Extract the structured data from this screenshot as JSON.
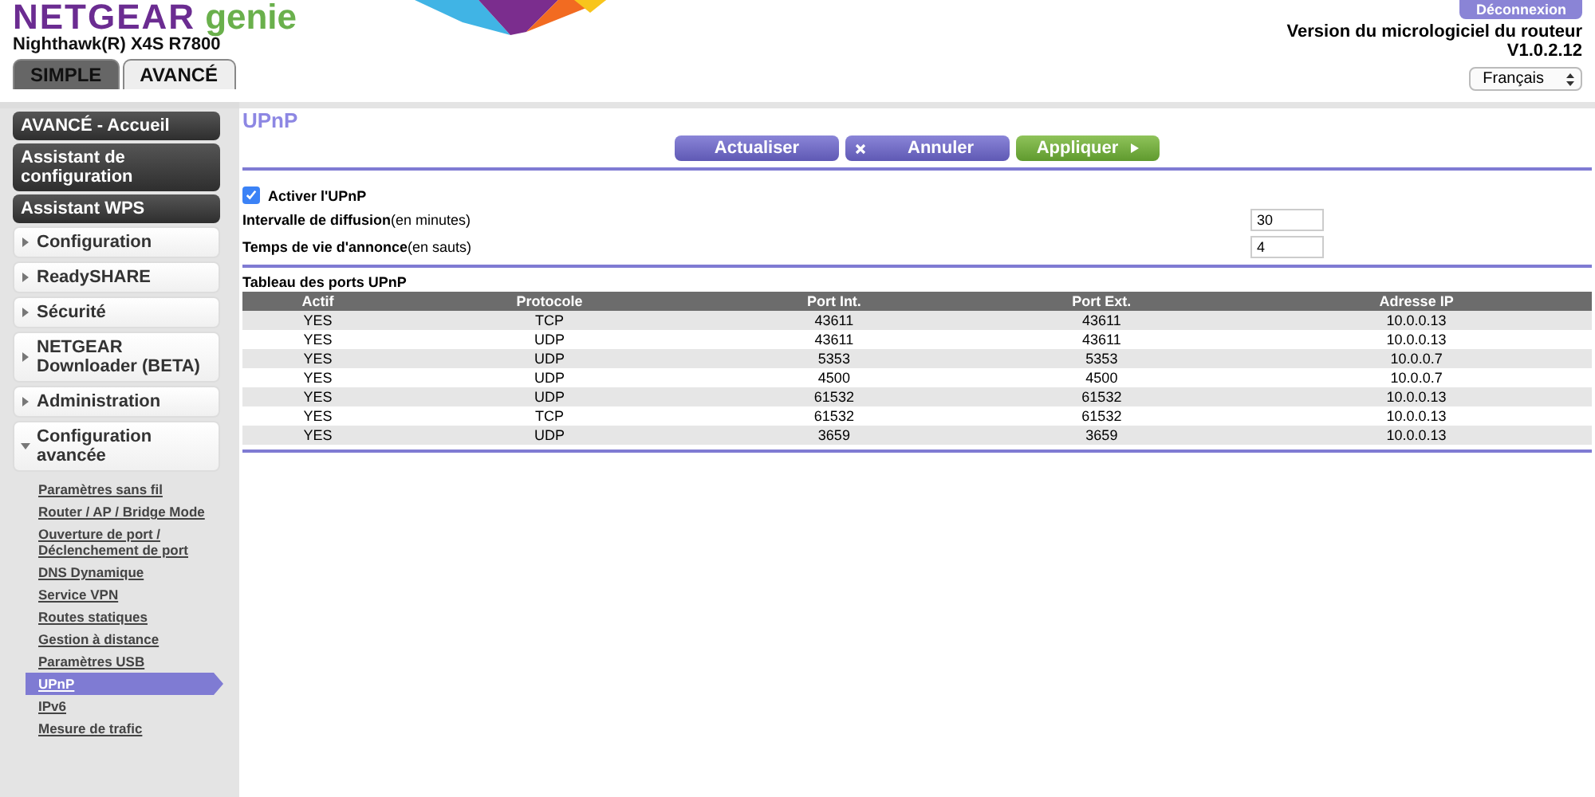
{
  "header": {
    "brand": "NETGEAR",
    "product": "genie",
    "model": "Nighthawk(R) X4S R7800",
    "logout": "Déconnexion",
    "firmware_label": "Version du micrologiciel du routeur",
    "firmware_version": "V1.0.2.12",
    "language": "Français"
  },
  "tabs": [
    {
      "label": "SIMPLE",
      "selected": false
    },
    {
      "label": "AVANCÉ",
      "selected": true
    }
  ],
  "sidebar": {
    "items": [
      {
        "kind": "button",
        "label": "AVANCÉ - Accueil"
      },
      {
        "kind": "button",
        "label": "Assistant de configuration"
      },
      {
        "kind": "button",
        "label": "Assistant WPS"
      },
      {
        "kind": "section",
        "label": "Configuration",
        "expanded": false
      },
      {
        "kind": "section",
        "label": "ReadySHARE",
        "expanded": false
      },
      {
        "kind": "section",
        "label": "Sécurité",
        "expanded": false
      },
      {
        "kind": "section",
        "label": "NETGEAR Downloader (BETA)",
        "expanded": false
      },
      {
        "kind": "section",
        "label": "Administration",
        "expanded": false
      },
      {
        "kind": "section",
        "label": "Configuration avancée",
        "expanded": true,
        "children": [
          {
            "label": "Paramètres sans fil",
            "selected": false
          },
          {
            "label": "Router / AP / Bridge Mode",
            "selected": false
          },
          {
            "label": "Ouverture de port / Déclenchement de port",
            "selected": false
          },
          {
            "label": "DNS Dynamique",
            "selected": false
          },
          {
            "label": "Service VPN",
            "selected": false
          },
          {
            "label": "Routes statiques",
            "selected": false
          },
          {
            "label": "Gestion à distance",
            "selected": false
          },
          {
            "label": "Paramètres USB",
            "selected": false
          },
          {
            "label": "UPnP",
            "selected": true
          },
          {
            "label": "IPv6",
            "selected": false
          },
          {
            "label": "Mesure de trafic",
            "selected": false
          }
        ]
      }
    ]
  },
  "main": {
    "title": "UPnP",
    "buttons": [
      {
        "kind": "refresh",
        "label": "Actualiser"
      },
      {
        "kind": "cancel",
        "label": "Annuler"
      },
      {
        "kind": "apply",
        "label": "Appliquer"
      }
    ],
    "enable": {
      "label": "Activer l'UPnP",
      "checked": true
    },
    "fields": [
      {
        "label": "**Intervalle de diffusion**(en minutes)",
        "value": "30"
      },
      {
        "label": "**Temps de vie d'annonce**(en sauts)",
        "value": "4"
      }
    ],
    "table": {
      "title": "Tableau des ports UPnP",
      "columns": [
        "Actif",
        "Protocole",
        "Port Int.",
        "Port Ext.",
        "Adresse IP"
      ],
      "rows": [
        [
          "YES",
          "TCP",
          "43611",
          "43611",
          "10.0.0.13"
        ],
        [
          "YES",
          "UDP",
          "43611",
          "43611",
          "10.0.0.13"
        ],
        [
          "YES",
          "UDP",
          "5353",
          "5353",
          "10.0.0.7"
        ],
        [
          "YES",
          "UDP",
          "4500",
          "4500",
          "10.0.0.7"
        ],
        [
          "YES",
          "UDP",
          "61532",
          "61532",
          "10.0.0.13"
        ],
        [
          "YES",
          "TCP",
          "61532",
          "61532",
          "10.0.0.13"
        ],
        [
          "YES",
          "UDP",
          "3659",
          "3659",
          "10.0.0.13"
        ]
      ]
    }
  }
}
